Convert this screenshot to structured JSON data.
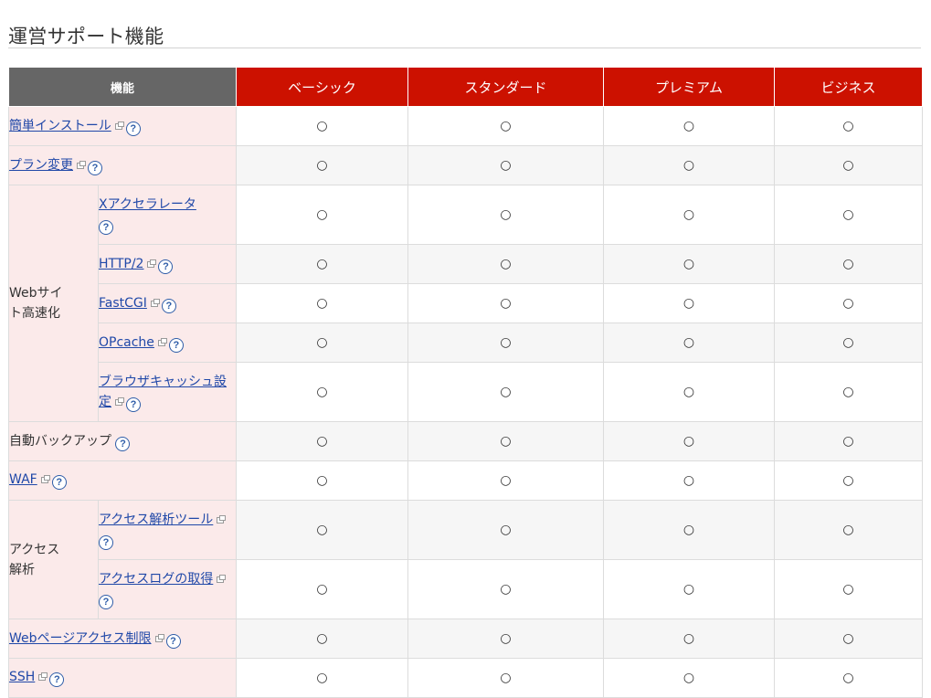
{
  "title": "運営サポート機能",
  "columns": {
    "feature": "機能",
    "plans": [
      "ベーシック",
      "スタンダード",
      "プレミアム",
      "ビジネス"
    ]
  },
  "check_mark": "○",
  "help_mark": "?",
  "colors": {
    "header_feature_bg": "#666666",
    "header_plan_bg": "#cc1100",
    "feature_cell_bg": "#fbeaea",
    "alt_row_bg": "#f6f6f6",
    "link": "#2048a8",
    "help_icon": "#2f5da8"
  },
  "groups": {
    "web_speedup": "Webサイト高速化",
    "access_analysis": "アクセス解析"
  },
  "rows": [
    {
      "label": "簡単インストール",
      "link": true,
      "external": true,
      "help": true
    },
    {
      "label": "プラン変更",
      "link": true,
      "external": true,
      "help": true
    },
    {
      "label": "Xアクセラレータ",
      "link": true,
      "external": false,
      "help": true,
      "group": "web_speedup"
    },
    {
      "label": "HTTP/2",
      "link": true,
      "external": true,
      "help": true,
      "group": "web_speedup"
    },
    {
      "label": "FastCGI",
      "link": true,
      "external": true,
      "help": true,
      "group": "web_speedup"
    },
    {
      "label": "OPcache",
      "link": true,
      "external": true,
      "help": true,
      "group": "web_speedup"
    },
    {
      "label": "ブラウザキャッシュ設定",
      "link": true,
      "external": true,
      "help": true,
      "group": "web_speedup"
    },
    {
      "label": "自動バックアップ",
      "link": false,
      "external": false,
      "help": true
    },
    {
      "label": "WAF",
      "link": true,
      "external": true,
      "help": true
    },
    {
      "label": "アクセス解析ツール",
      "link": true,
      "external": true,
      "help": true,
      "group": "access_analysis"
    },
    {
      "label": "アクセスログの取得",
      "link": true,
      "external": true,
      "help": true,
      "group": "access_analysis"
    },
    {
      "label": "Webページアクセス制限",
      "link": true,
      "external": true,
      "help": true
    },
    {
      "label": "SSH",
      "link": true,
      "external": true,
      "help": true
    }
  ],
  "availability": [
    [
      "○",
      "○",
      "○",
      "○"
    ],
    [
      "○",
      "○",
      "○",
      "○"
    ],
    [
      "○",
      "○",
      "○",
      "○"
    ],
    [
      "○",
      "○",
      "○",
      "○"
    ],
    [
      "○",
      "○",
      "○",
      "○"
    ],
    [
      "○",
      "○",
      "○",
      "○"
    ],
    [
      "○",
      "○",
      "○",
      "○"
    ],
    [
      "○",
      "○",
      "○",
      "○"
    ],
    [
      "○",
      "○",
      "○",
      "○"
    ],
    [
      "○",
      "○",
      "○",
      "○"
    ],
    [
      "○",
      "○",
      "○",
      "○"
    ],
    [
      "○",
      "○",
      "○",
      "○"
    ],
    [
      "○",
      "○",
      "○",
      "○"
    ]
  ]
}
